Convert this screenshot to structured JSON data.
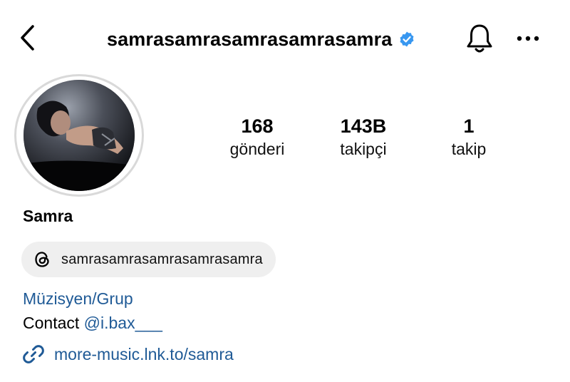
{
  "header": {
    "back_icon": "chevron-left-icon",
    "username": "samrasamrasamrasamrasamra",
    "verified_icon": "verified-badge-icon",
    "verified_color": "#3897f0",
    "notification_icon": "bell-icon",
    "more_icon": "more-horizontal-icon"
  },
  "profile": {
    "avatar_alt": "profile-photo",
    "stats": [
      {
        "value": "168",
        "label": "gönderi"
      },
      {
        "value": "143B",
        "label": "takipçi"
      },
      {
        "value": "1",
        "label": "takip"
      }
    ],
    "display_name": "Samra",
    "threads": {
      "icon": "threads-icon",
      "handle": "samrasamrasamrasamrasamra"
    },
    "category": "Müzisyen/Grup",
    "contact": {
      "prefix": "Contact ",
      "handle": "@i.bax___"
    },
    "link": {
      "icon": "link-icon",
      "text": "more-music.lnk.to/samra"
    }
  },
  "colors": {
    "link_blue": "#1f5a96",
    "pill_bg": "#efefef",
    "ring_gray": "#d9d9d9"
  }
}
